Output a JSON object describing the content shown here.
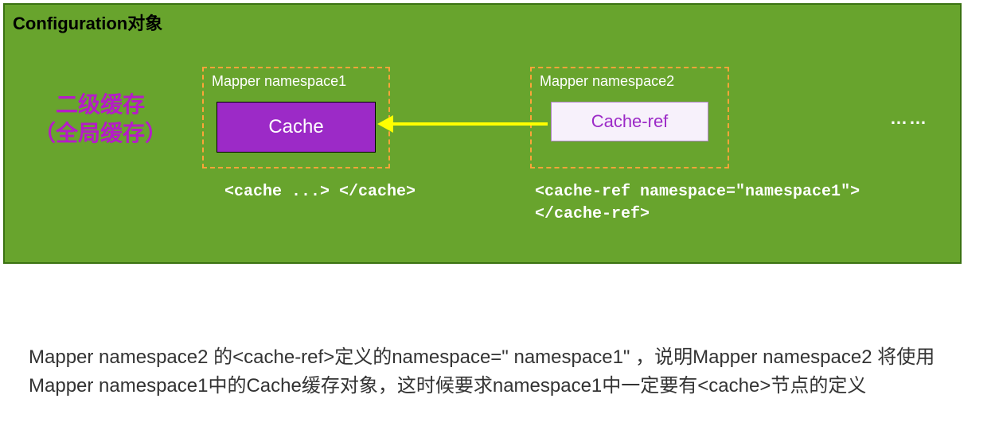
{
  "title": "Configuration对象",
  "l2_cache": {
    "line1": "二级缓存",
    "line2": "（全局缓存）"
  },
  "namespace1": {
    "label": "Mapper namespace1",
    "box_label": "Cache",
    "code": "<cache ...> </cache>"
  },
  "namespace2": {
    "label": "Mapper namespace2",
    "box_label": "Cache-ref",
    "code": "<cache-ref namespace=\"namespace1\"> </cache-ref>"
  },
  "ellipsis": "……",
  "caption": "Mapper namespace2 的<cache-ref>定义的namespace=\" namespace1\" ，说明Mapper namespace2 将使用Mapper namespace1中的Cache缓存对象，这时候要求namespace1中一定要有<cache>节点的定义",
  "colors": {
    "panel_bg": "#68a42d",
    "panel_border": "#3b7212",
    "dashed_border": "#fca439",
    "cache_bg": "#9c2ac7",
    "arrow": "#ffff00",
    "l2_label": "#b51cc7"
  },
  "chart_data": {
    "type": "diagram",
    "nodes": [
      {
        "id": "config",
        "label": "Configuration对象",
        "kind": "container"
      },
      {
        "id": "l2_cache_label",
        "label": "二级缓存（全局缓存）",
        "kind": "label"
      },
      {
        "id": "ns1",
        "label": "Mapper namespace1",
        "kind": "namespace",
        "code": "<cache ...> </cache>"
      },
      {
        "id": "cache",
        "label": "Cache",
        "parent": "ns1",
        "kind": "cache"
      },
      {
        "id": "ns2",
        "label": "Mapper namespace2",
        "kind": "namespace",
        "code": "<cache-ref namespace=\"namespace1\"> </cache-ref>"
      },
      {
        "id": "cache_ref",
        "label": "Cache-ref",
        "parent": "ns2",
        "kind": "cache-ref"
      },
      {
        "id": "more",
        "label": "……",
        "kind": "ellipsis"
      }
    ],
    "edges": [
      {
        "from": "cache_ref",
        "to": "cache",
        "style": "solid-arrow",
        "color": "#ffff00",
        "meaning": "references"
      }
    ]
  }
}
